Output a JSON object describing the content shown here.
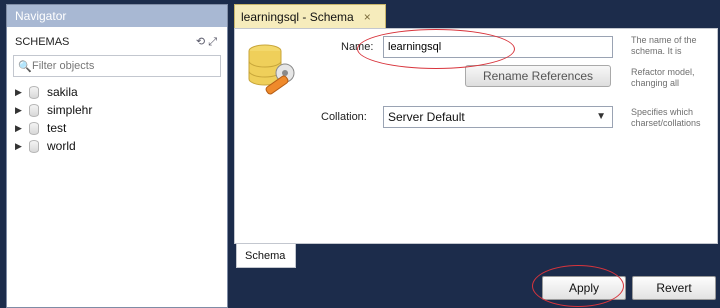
{
  "navigator": {
    "title": "Navigator",
    "schemas_label": "SCHEMAS",
    "header_icons": "⟲ ⤢",
    "filter_placeholder": "Filter objects",
    "schemas": [
      "sakila",
      "simplehr",
      "test",
      "world"
    ]
  },
  "editor": {
    "tab_title": "learningsql - Schema",
    "tab_close": "×",
    "name_label": "Name:",
    "name_value": "learningsql",
    "rename_button": "Rename References",
    "collation_label": "Collation:",
    "collation_value": "Server Default",
    "name_hint": "The name of the schema. It is",
    "rename_hint": "Refactor model, changing all",
    "collation_hint": "Specifies which charset/collations",
    "bottom_tab": "Schema"
  },
  "footer": {
    "apply_button": "Apply",
    "revert_button": "Revert"
  },
  "colors": {
    "background": "#1c2c4b",
    "annotation": "#d8343c",
    "tab": "#f6ecbc"
  }
}
